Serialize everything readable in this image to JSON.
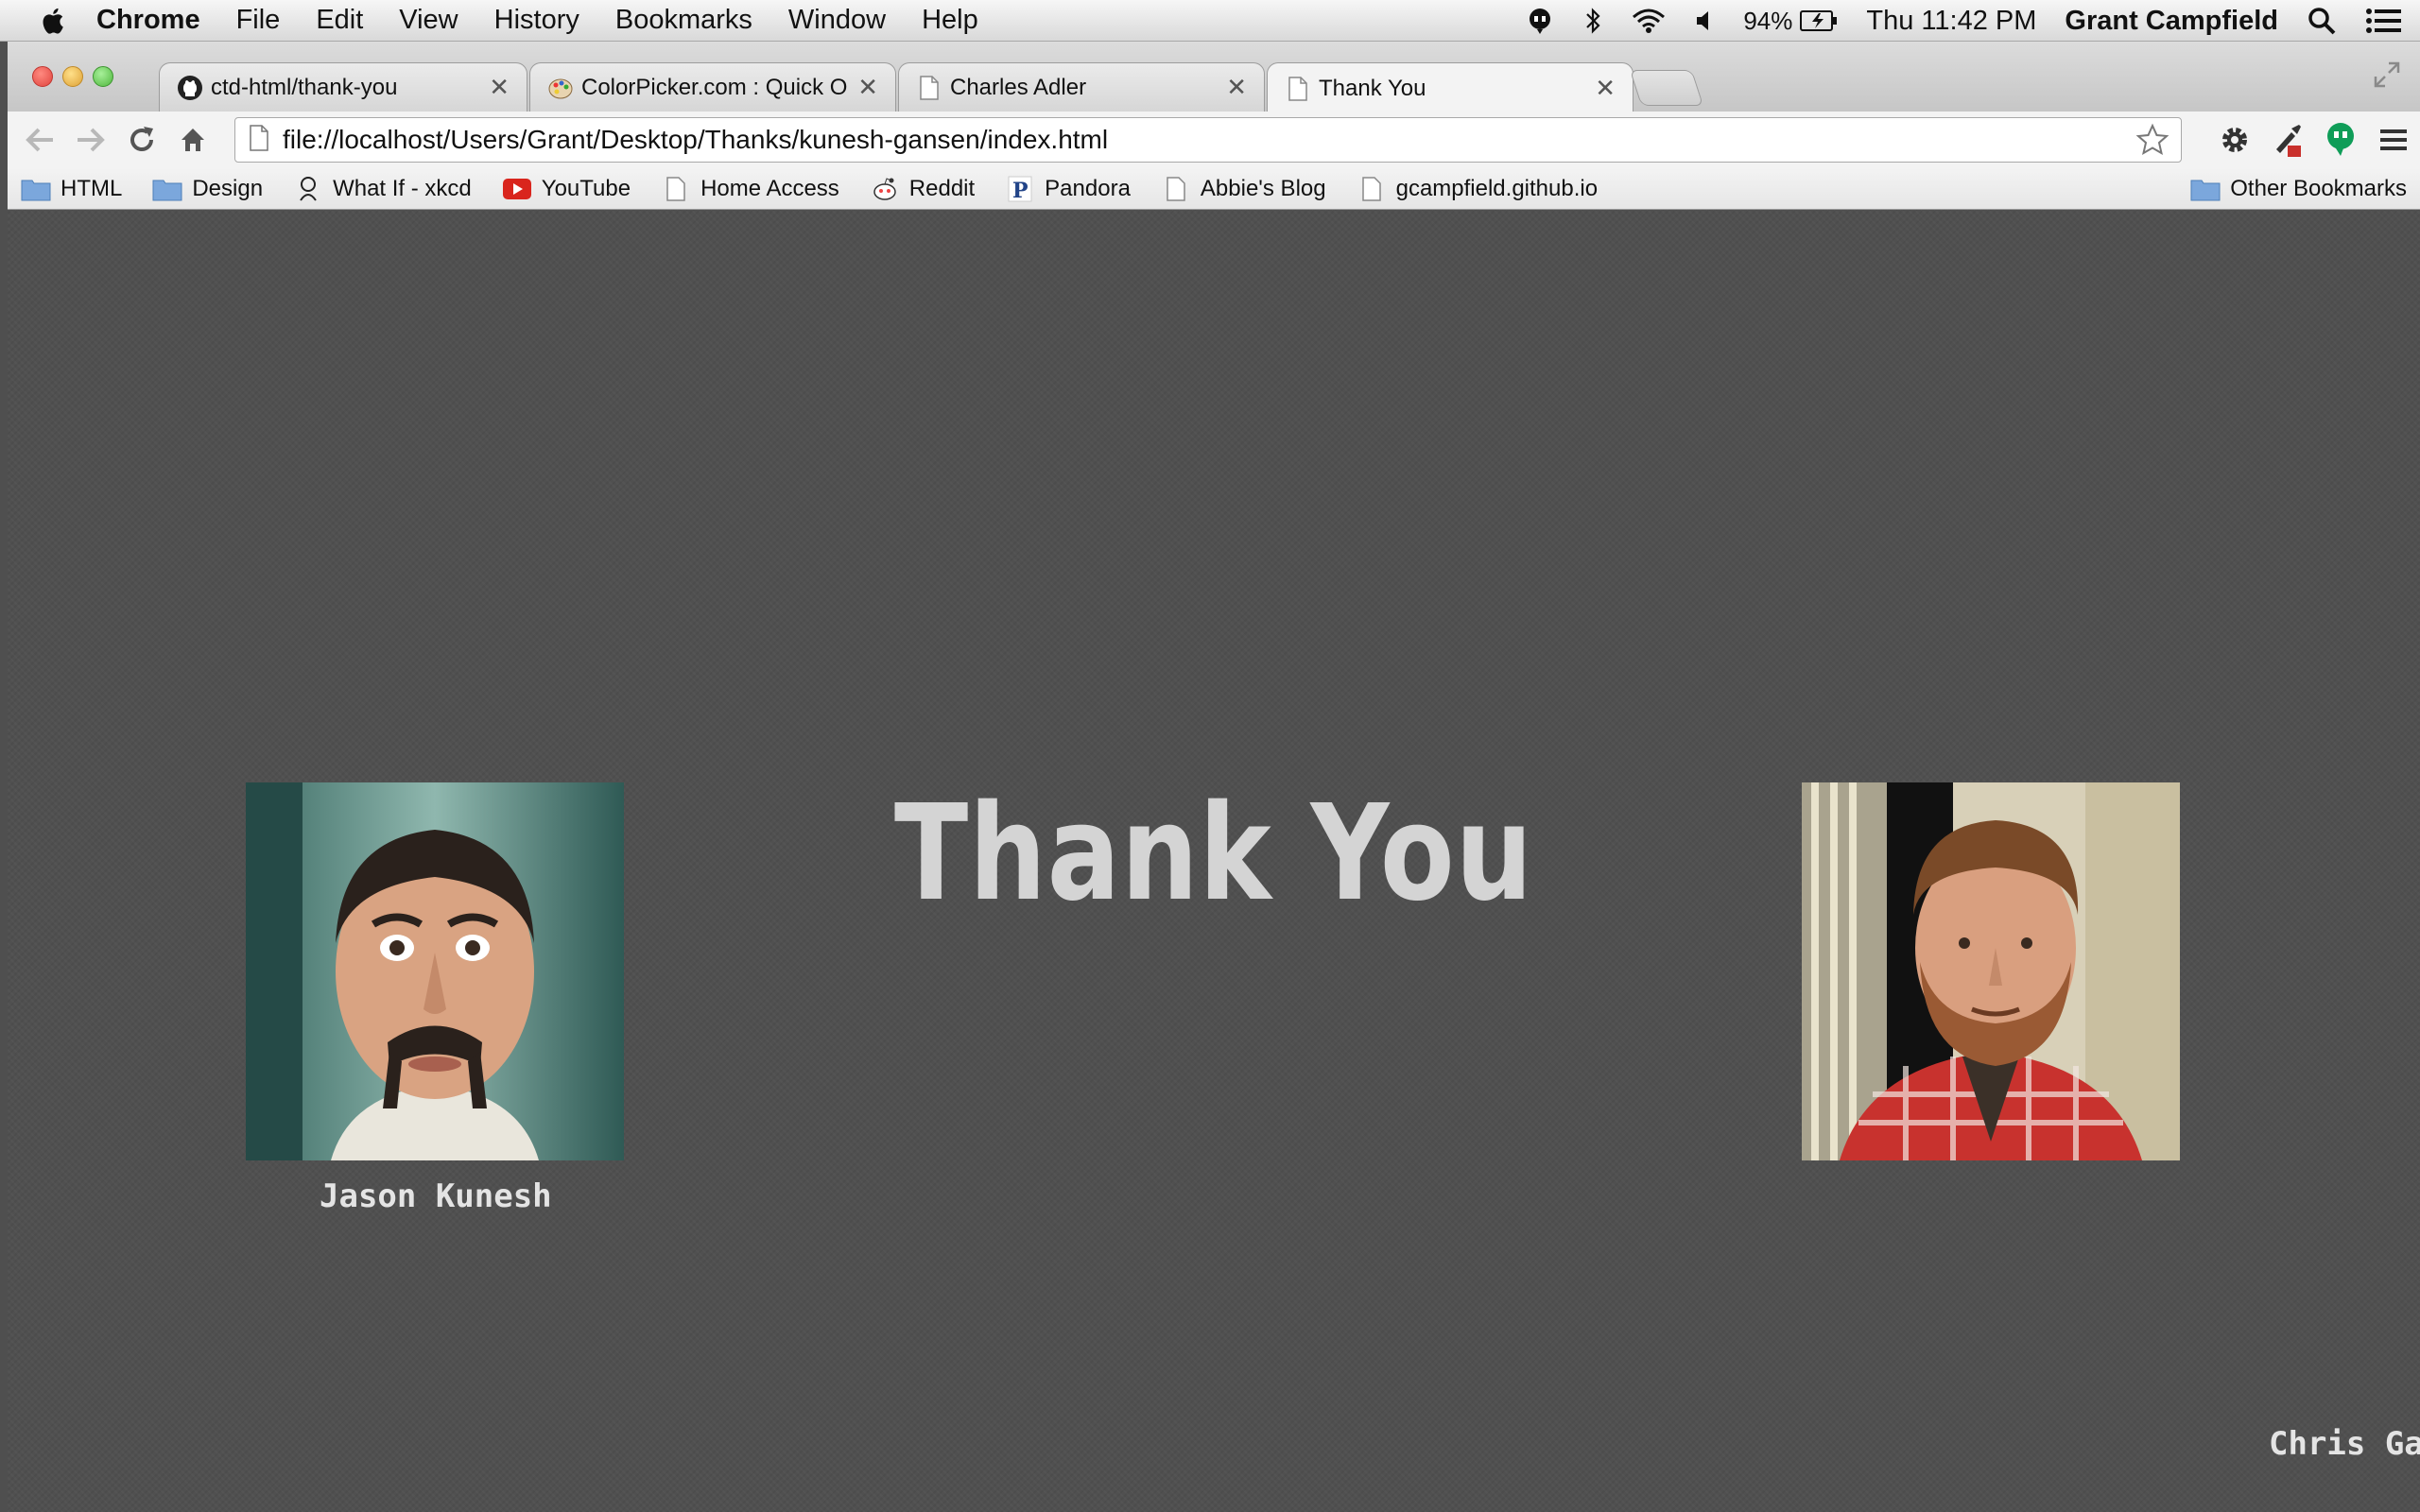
{
  "menubar": {
    "app_name": "Chrome",
    "items": [
      "File",
      "Edit",
      "View",
      "History",
      "Bookmarks",
      "Window",
      "Help"
    ],
    "battery": "94%",
    "clock": "Thu 11:42 PM",
    "user": "Grant Campfield"
  },
  "tabs": [
    {
      "title": "ctd-html/thank-you",
      "icon": "github-icon",
      "active": false
    },
    {
      "title": "ColorPicker.com : Quick Online Color Picker",
      "icon": "palette-icon",
      "active": false
    },
    {
      "title": "Charles Adler",
      "icon": "page-icon",
      "active": false
    },
    {
      "title": "Thank You",
      "icon": "page-icon",
      "active": true
    }
  ],
  "toolbar": {
    "url": "file://localhost/Users/Grant/Desktop/Thanks/kunesh-gansen/index.html"
  },
  "bookmarks": [
    {
      "label": "HTML",
      "icon": "folder-icon"
    },
    {
      "label": "Design",
      "icon": "folder-icon"
    },
    {
      "label": "What If - xkcd",
      "icon": "xkcd-icon"
    },
    {
      "label": "YouTube",
      "icon": "youtube-icon"
    },
    {
      "label": "Home Access",
      "icon": "page-icon"
    },
    {
      "label": "Reddit",
      "icon": "reddit-icon"
    },
    {
      "label": "Pandora",
      "icon": "pandora-icon"
    },
    {
      "label": "Abbie's Blog",
      "icon": "page-icon"
    },
    {
      "label": "gcampfield.github.io",
      "icon": "page-icon"
    }
  ],
  "other_bookmarks": "Other Bookmarks",
  "page": {
    "headline": "Thank You",
    "people": [
      {
        "name": "Jason Kunesh"
      },
      {
        "name": "Chris Ga"
      }
    ]
  },
  "colors": {
    "page_background": "#505050",
    "headline": "#d4d4d4",
    "caption": "#e4e4e4"
  }
}
